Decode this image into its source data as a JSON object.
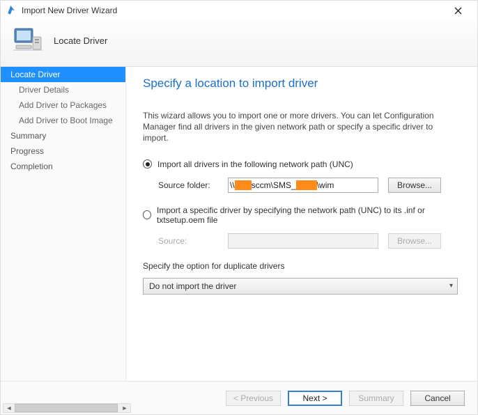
{
  "window": {
    "title": "Import New Driver Wizard"
  },
  "header": {
    "page_title": "Locate Driver"
  },
  "sidebar": {
    "items": [
      {
        "label": "Locate Driver",
        "active": true,
        "sub": false
      },
      {
        "label": "Driver Details",
        "active": false,
        "sub": true
      },
      {
        "label": "Add Driver to Packages",
        "active": false,
        "sub": true
      },
      {
        "label": "Add Driver to Boot Image",
        "active": false,
        "sub": true
      },
      {
        "label": "Summary",
        "active": false,
        "sub": false
      },
      {
        "label": "Progress",
        "active": false,
        "sub": false
      },
      {
        "label": "Completion",
        "active": false,
        "sub": false
      }
    ]
  },
  "content": {
    "heading": "Specify a location to import driver",
    "intro": "This wizard allows you to import one or more drivers. You can let Configuration Manager find all drivers in the given network path or specify a specific driver to import.",
    "option_all": {
      "label": "Import all drivers in the following network path (UNC)",
      "selected": true,
      "field_label": "Source folder:",
      "value_prefix": "\\\\",
      "value_mid1": "sccm\\SMS_",
      "value_suffix": "\\wim",
      "browse": "Browse..."
    },
    "option_specific": {
      "label": "Import a specific driver by specifying the network path (UNC) to its .inf or txtsetup.oem file",
      "selected": false,
      "field_label": "Source:",
      "browse": "Browse..."
    },
    "dup": {
      "label": "Specify the option for duplicate drivers",
      "selected": "Do not import the driver"
    }
  },
  "footer": {
    "previous": "< Previous",
    "next": "Next >",
    "summary": "Summary",
    "cancel": "Cancel"
  }
}
